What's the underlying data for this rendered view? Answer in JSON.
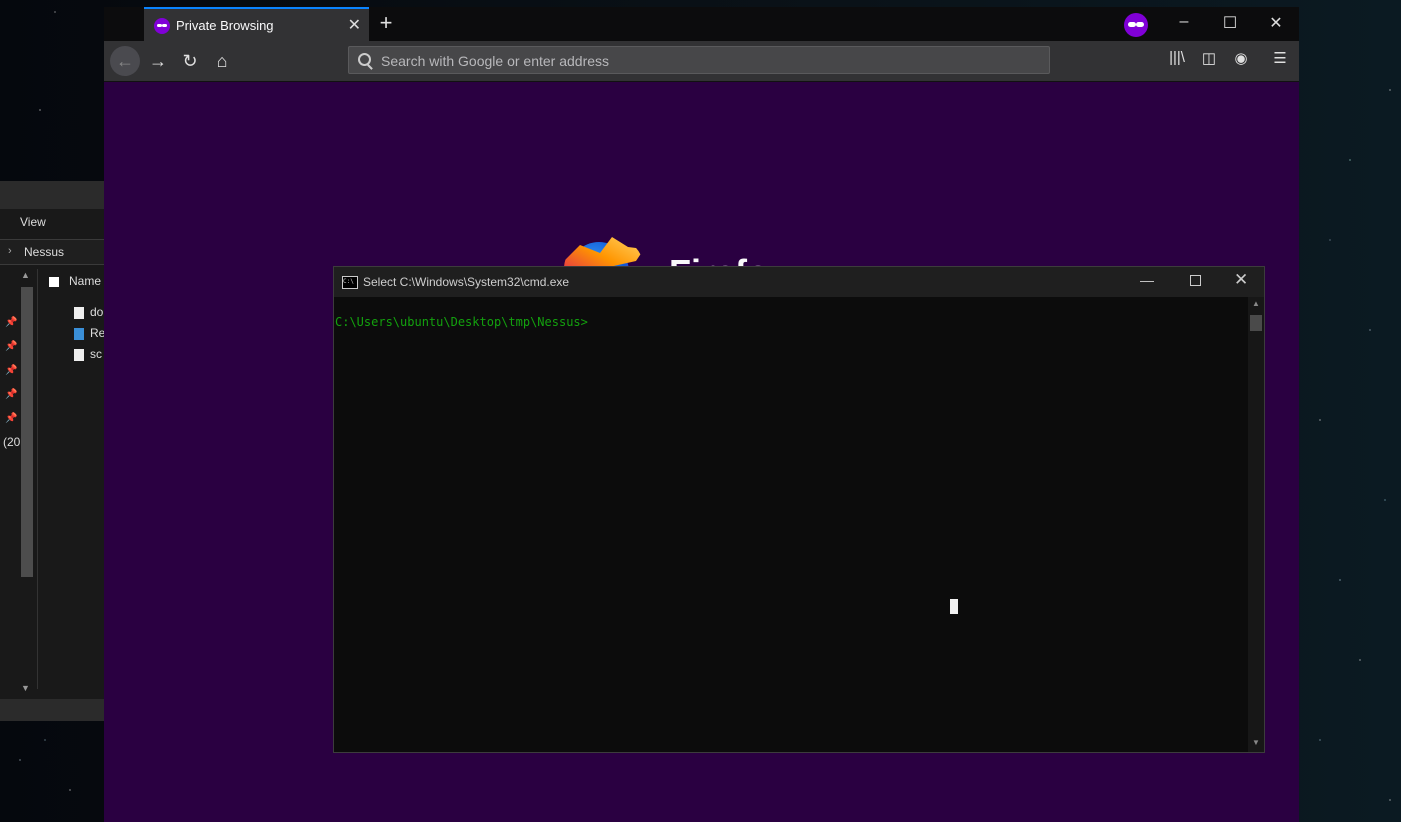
{
  "explorer": {
    "view_menu": "View",
    "breadcrumb": "Nessus",
    "column_name": "Name",
    "files": [
      "do",
      "Re",
      "sc"
    ],
    "year_fragment": "(20"
  },
  "browser": {
    "tab_title": "Private Browsing",
    "url_placeholder": "Search with Google or enter address",
    "wordmark": "Firefox",
    "accent_color": "#8000d7",
    "page_bg": "#2a0041"
  },
  "cmd": {
    "title": "Select C:\\Windows\\System32\\cmd.exe",
    "prompt": "C:\\Users\\ubuntu\\Desktop\\tmp\\Nessus>",
    "text_color": "#13a10e"
  }
}
